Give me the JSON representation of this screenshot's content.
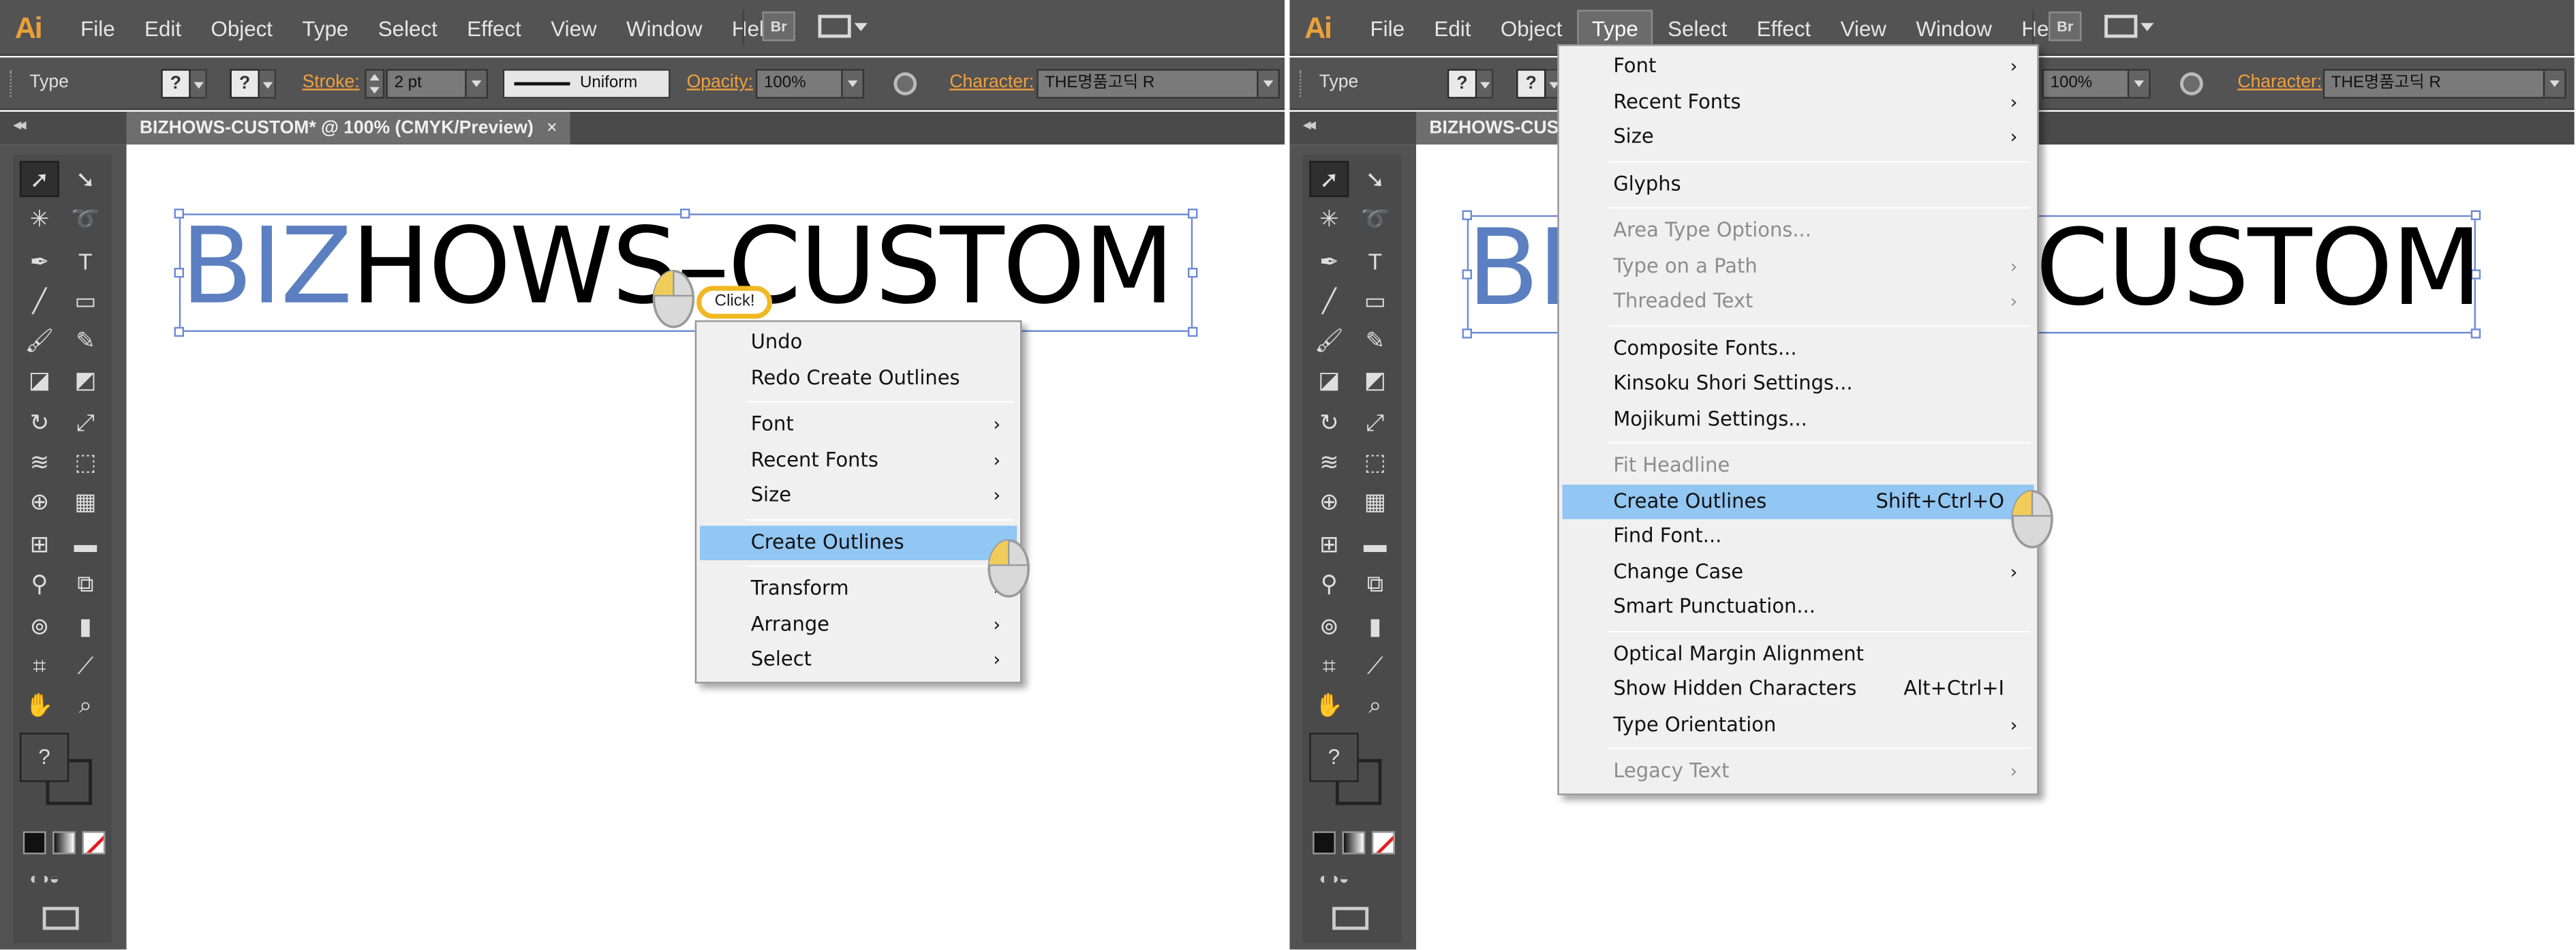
{
  "app": {
    "logo": "Ai",
    "menus": [
      "File",
      "Edit",
      "Object",
      "Type",
      "Select",
      "Effect",
      "View",
      "Window",
      "Help"
    ],
    "bridge_icon": "Br",
    "workspace_icon": "workspace-switcher-icon"
  },
  "control_bar": {
    "tool_name": "Type",
    "stroke_label": "Stroke:",
    "stroke_value": "2 pt",
    "brush_label": "Uniform",
    "opacity_label": "Opacity:",
    "opacity_value": "100%",
    "character_label": "Character:",
    "font_value": "THE명품고딕 R",
    "swatch_unknown": "?"
  },
  "document": {
    "tab_title": "BIZHOWS-CUSTOM* @ 100% (CMYK/Preview)",
    "tab_title_short": "BIZHOWS-CUS",
    "tab_close": "×",
    "art_text_blue": "BIZ",
    "art_text_black": "HOWS–CUSTOM",
    "art_text_right": "CUSTOM"
  },
  "left_panel": {
    "click_label": "Click!",
    "context_menu": [
      {
        "label": "Undo"
      },
      {
        "label": "Redo Create Outlines"
      },
      {
        "sep": true
      },
      {
        "label": "Font",
        "submenu": true
      },
      {
        "label": "Recent Fonts",
        "submenu": true
      },
      {
        "label": "Size",
        "submenu": true
      },
      {
        "sep": true
      },
      {
        "label": "Create Outlines",
        "highlighted": true
      },
      {
        "sep": true
      },
      {
        "label": "Transform",
        "submenu": true
      },
      {
        "label": "Arrange",
        "submenu": true
      },
      {
        "label": "Select",
        "submenu": true
      }
    ]
  },
  "right_panel": {
    "active_menu": "Type",
    "type_menu": [
      {
        "label": "Font",
        "submenu": true
      },
      {
        "label": "Recent Fonts",
        "submenu": true
      },
      {
        "label": "Size",
        "submenu": true
      },
      {
        "sep": true
      },
      {
        "label": "Glyphs"
      },
      {
        "sep": true
      },
      {
        "label": "Area Type Options...",
        "disabled": true
      },
      {
        "label": "Type on a Path",
        "submenu": true,
        "disabled": true
      },
      {
        "label": "Threaded Text",
        "submenu": true,
        "disabled": true
      },
      {
        "sep": true
      },
      {
        "label": "Composite Fonts..."
      },
      {
        "label": "Kinsoku Shori Settings..."
      },
      {
        "label": "Mojikumi Settings..."
      },
      {
        "sep": true
      },
      {
        "label": "Fit Headline",
        "disabled": true
      },
      {
        "label": "Create Outlines",
        "shortcut": "Shift+Ctrl+O",
        "highlighted": true
      },
      {
        "label": "Find Font..."
      },
      {
        "label": "Change Case",
        "submenu": true
      },
      {
        "label": "Smart Punctuation..."
      },
      {
        "sep": true
      },
      {
        "label": "Optical Margin Alignment"
      },
      {
        "label": "Show Hidden Characters",
        "shortcut": "Alt+Ctrl+I"
      },
      {
        "label": "Type Orientation",
        "submenu": true
      },
      {
        "sep": true
      },
      {
        "label": "Legacy Text",
        "submenu": true,
        "disabled": true
      }
    ]
  },
  "colors": {
    "chrome": "#535353",
    "highlight": "#92c6f3",
    "art_blue": "#5b7fc0",
    "accent_orange": "#f0a040",
    "click_ring": "#f0b823"
  }
}
